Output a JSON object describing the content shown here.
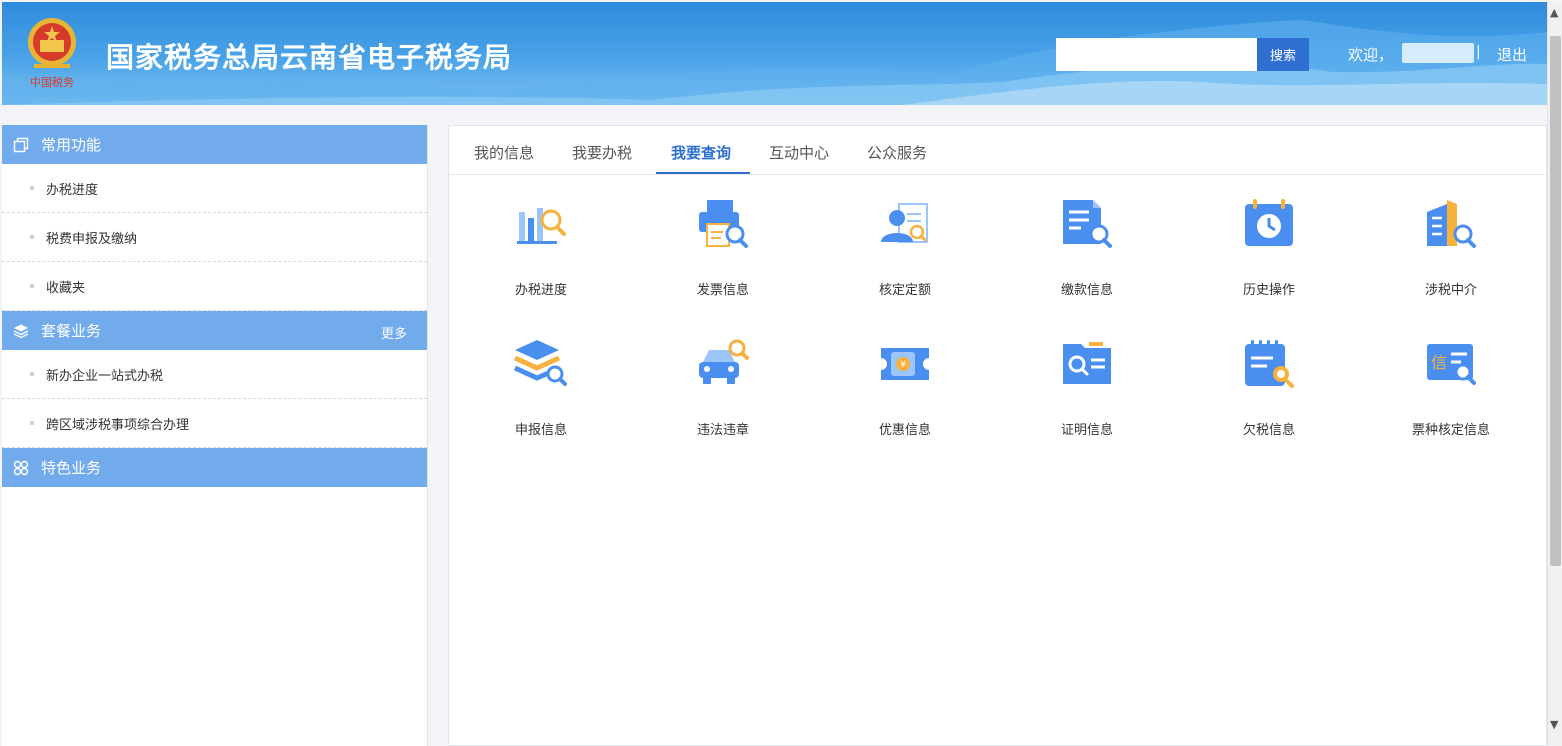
{
  "header": {
    "title": "国家税务总局云南省电子税务局",
    "emblem_caption": "中国税务",
    "search_placeholder": "",
    "search_label": "搜索",
    "welcome": "欢迎，",
    "separator": "|",
    "logout": "退出"
  },
  "sidebar": {
    "sections": [
      {
        "title": "常用功能",
        "icon": "copy-icon",
        "items": [
          "办税进度",
          "税费申报及缴纳",
          "收藏夹"
        ]
      },
      {
        "title": "套餐业务",
        "icon": "layers-icon",
        "more": "更多",
        "items": [
          "新办企业一站式办税",
          "跨区域涉税事项综合办理"
        ]
      },
      {
        "title": "特色业务",
        "icon": "clover-icon",
        "items": []
      }
    ]
  },
  "tabs": [
    "我的信息",
    "我要办税",
    "我要查询",
    "互动中心",
    "公众服务"
  ],
  "active_tab": "我要查询",
  "tiles": [
    {
      "label": "办税进度",
      "icon": "bar-chart-search-icon"
    },
    {
      "label": "发票信息",
      "icon": "printer-search-icon"
    },
    {
      "label": "核定定额",
      "icon": "user-card-icon"
    },
    {
      "label": "缴款信息",
      "icon": "document-search-icon"
    },
    {
      "label": "历史操作",
      "icon": "calendar-history-icon"
    },
    {
      "label": "涉税中介",
      "icon": "building-search-icon"
    },
    {
      "label": "申报信息",
      "icon": "stack-search-icon"
    },
    {
      "label": "违法违章",
      "icon": "car-search-icon"
    },
    {
      "label": "优惠信息",
      "icon": "coupon-icon"
    },
    {
      "label": "证明信息",
      "icon": "folder-search-icon"
    },
    {
      "label": "欠税信息",
      "icon": "notepad-search-icon"
    },
    {
      "label": "票种核定信息",
      "icon": "letter-search-icon"
    }
  ],
  "colors": {
    "primary": "#2f6fd1",
    "sidebar_header": "#72abec",
    "icon_blue": "#4a8ff0",
    "icon_light": "#9cc6fa",
    "icon_orange": "#f6b23c"
  }
}
